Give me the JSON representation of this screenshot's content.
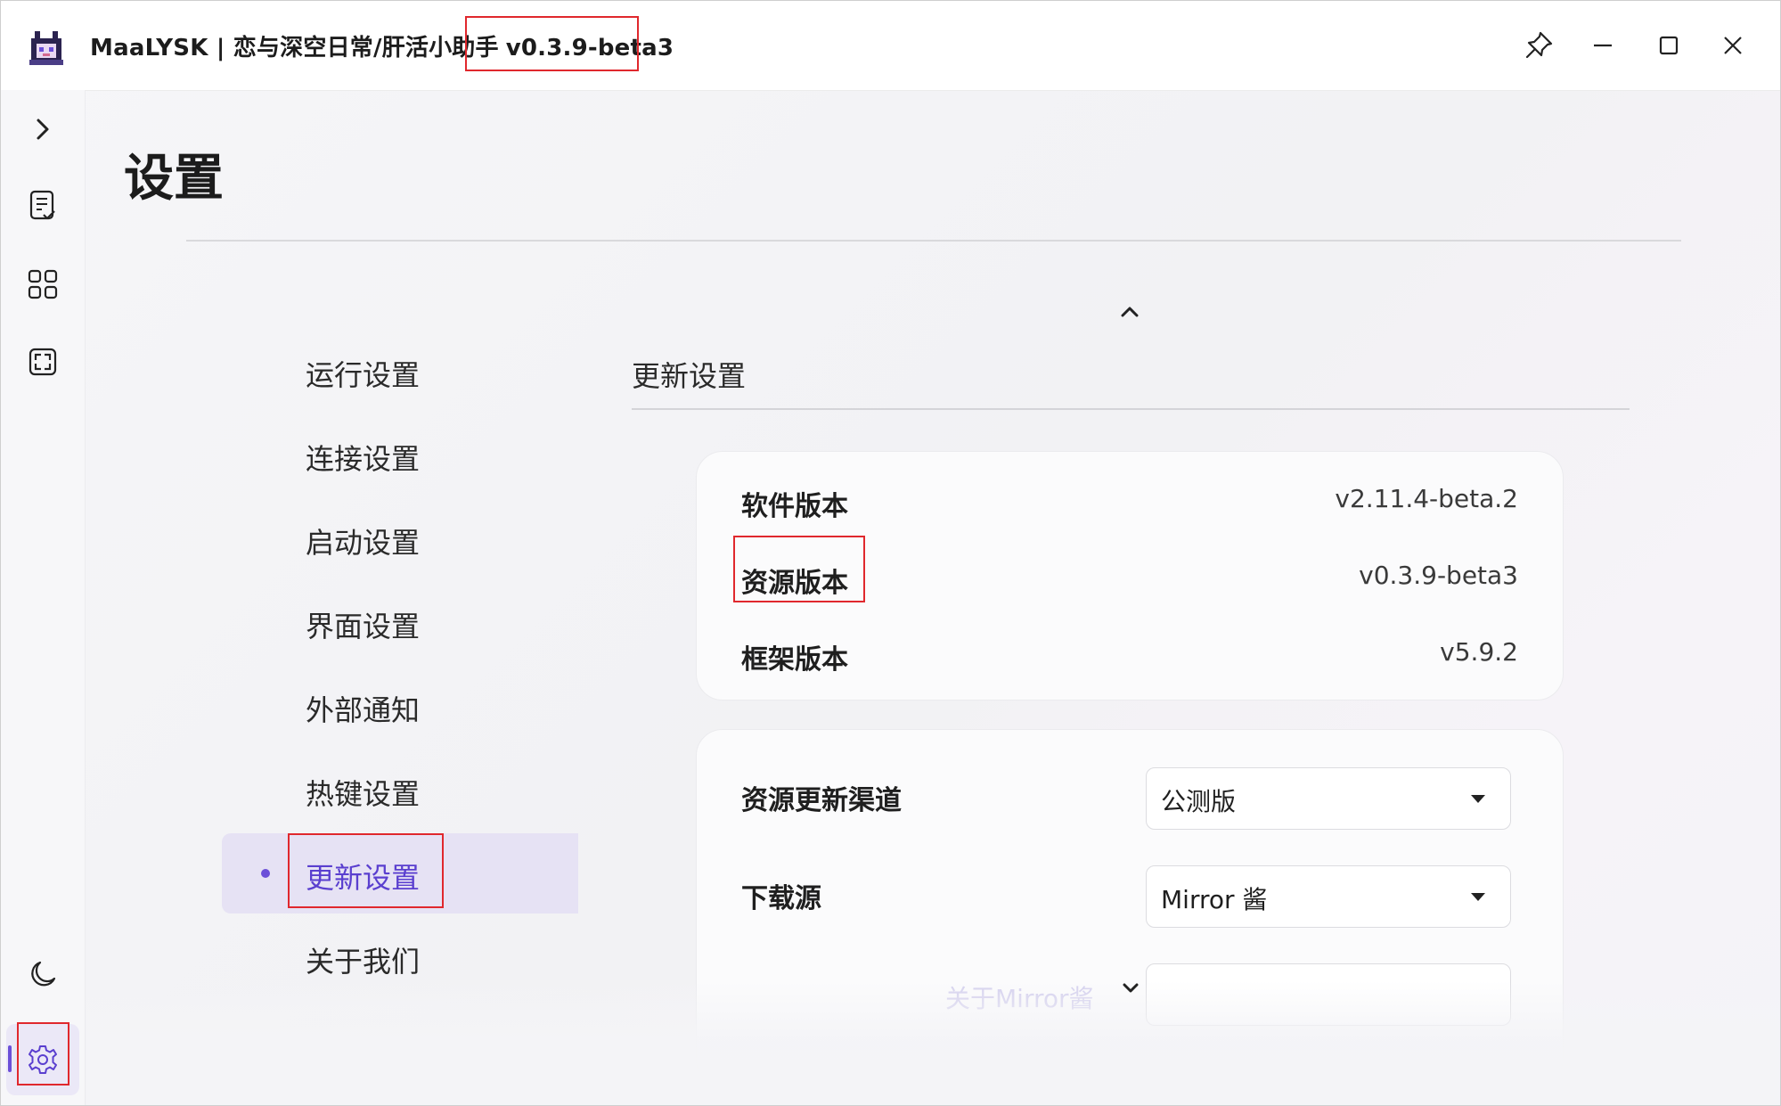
{
  "titlebar": {
    "title": "MaaLYSK | 恋与深空日常/肝活小助手",
    "version": "v0.3.9-beta3",
    "buttons": [
      "pin-icon",
      "minimize-icon",
      "maximize-icon",
      "close-icon"
    ]
  },
  "rail": {
    "items": [
      "chevron-right-icon",
      "task-list-icon",
      "grid-icon",
      "screenshot-icon",
      "moon-icon",
      "gear-icon"
    ]
  },
  "page": {
    "title": "设置"
  },
  "nav": {
    "items": [
      {
        "label": "运行设置"
      },
      {
        "label": "连接设置"
      },
      {
        "label": "启动设置"
      },
      {
        "label": "界面设置"
      },
      {
        "label": "外部通知"
      },
      {
        "label": "热键设置"
      },
      {
        "label": "更新设置",
        "active": true
      },
      {
        "label": "关于我们"
      }
    ]
  },
  "section": {
    "title": "更新设置",
    "versions": [
      {
        "label": "软件版本",
        "value": "v2.11.4-beta.2"
      },
      {
        "label": "资源版本",
        "value": "v0.3.9-beta3"
      },
      {
        "label": "框架版本",
        "value": "v5.9.2"
      }
    ],
    "options": [
      {
        "label": "资源更新渠道",
        "value": "公测版"
      },
      {
        "label": "下载源",
        "value": "Mirror 酱"
      }
    ],
    "faded_link": "关于Mirror酱"
  },
  "colors": {
    "accent": "#6b4fd8",
    "highlight_box": "#e0282d"
  }
}
